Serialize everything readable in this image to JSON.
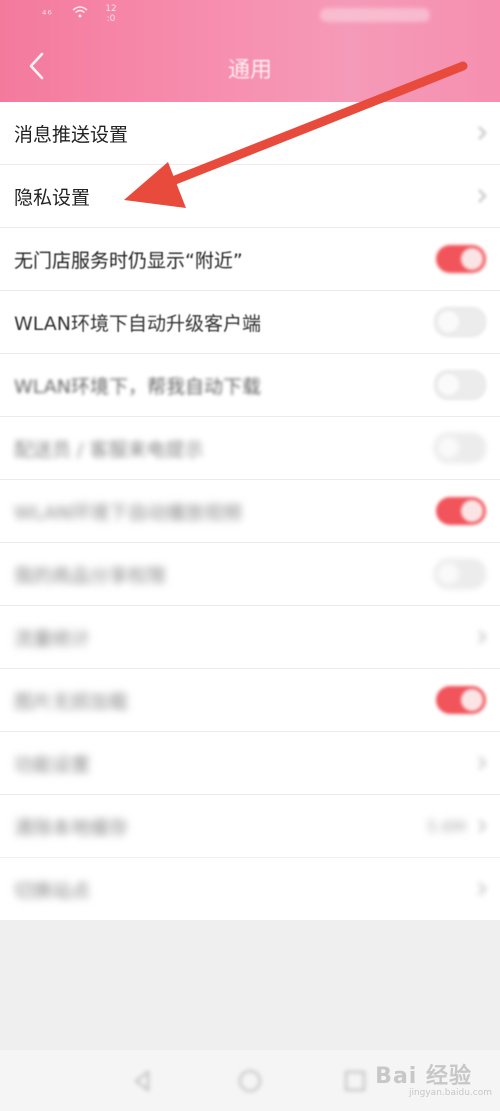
{
  "status": {
    "signal": "⁴⁶",
    "time": "12 :0"
  },
  "header": {
    "title": "通用"
  },
  "settings": [
    {
      "label": "消息推送设置",
      "control": "chevron"
    },
    {
      "label": "隐私设置",
      "control": "chevron"
    },
    {
      "label": "无门店服务时仍显示“附近”",
      "control": "toggle",
      "on": true
    },
    {
      "label": "WLAN环境下自动升级客户端",
      "control": "toggle",
      "on": false
    },
    {
      "label": "WLAN环境下，帮我自动下载",
      "control": "toggle",
      "on": false
    },
    {
      "label": "配送员 / 客服来电提示",
      "control": "toggle",
      "on": false
    },
    {
      "label": "WLAN环境下自动播放视频",
      "control": "toggle",
      "on": true
    },
    {
      "label": "我的商品分享权限",
      "control": "toggle",
      "on": false
    },
    {
      "label": "流量统计",
      "control": "chevron"
    },
    {
      "label": "图片无损加载",
      "control": "toggle",
      "on": true
    },
    {
      "label": "功能设置",
      "control": "chevron"
    },
    {
      "label": "清除本地缓存",
      "control": "value",
      "value": "5.6M"
    }
  ],
  "bottom": {
    "label": "切换站点"
  },
  "watermark": {
    "brand": "Bai 经验",
    "sub": "jingyan.baidu.com"
  },
  "colors": {
    "header_accent": "#f47a9c",
    "toggle_on": "#f2545b",
    "arrow": "#e84a3c"
  }
}
